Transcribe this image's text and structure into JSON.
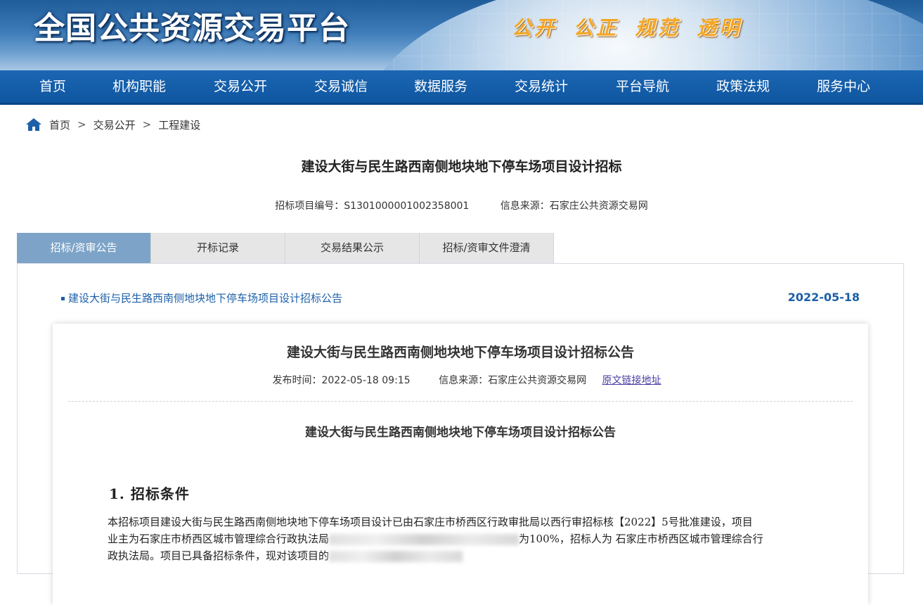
{
  "banner": {
    "site_title": "全国公共资源交易平台",
    "motto": "公开 公正 规范 透明"
  },
  "nav": {
    "items": [
      "首页",
      "机构职能",
      "交易公开",
      "交易诚信",
      "数据服务",
      "交易统计",
      "平台导航",
      "政策法规",
      "服务中心"
    ]
  },
  "breadcrumb": {
    "home": "首页",
    "level1": "交易公开",
    "level2": "工程建设",
    "separator": ">"
  },
  "project": {
    "title": "建设大街与民生路西南侧地块地下停车场项目设计招标",
    "code_label": "招标项目编号：",
    "code": "S1301000001002358001",
    "source_label": "信息来源：",
    "source": "石家庄公共资源交易网"
  },
  "tabs": [
    "招标/资审公告",
    "开标记录",
    "交易结果公示",
    "招标/资审文件澄清"
  ],
  "active_tab": 0,
  "notice": {
    "link_text": "建设大街与民生路西南侧地块地下停车场项目设计招标公告",
    "date": "2022-05-18"
  },
  "document": {
    "title": "建设大街与民生路西南侧地块地下停车场项目设计招标公告",
    "publish_label": "发布时间：",
    "publish_time": "2022-05-18 09:15",
    "source_label": "信息来源：",
    "source": "石家庄公共资源交易网",
    "original_link": "原文链接地址",
    "subtitle": "建设大街与民生路西南侧地块地下停车场项目设计招标公告",
    "section_heading": "1. 招标条件",
    "para_line1": "本招标项目建设大街与民生路西南侧地块地下停车场项目设计已由石家庄市桥西区行政审批局以西行审招标核【2022】5号批准建设，项目",
    "para_line2a": "业主为石家庄市桥西区城市管理综合行政执法局",
    "para_line2b": "为100%，招标人为 石家庄市桥西区城市管理综合行",
    "para_line3a": "政执法局。项目已具备招标条件，现对该项目的",
    "para_line3b": ""
  },
  "colors": {
    "nav_bg": "#0f56a0",
    "tab_active": "#7da4c8",
    "link": "#1c5fa8",
    "motto": "#f5a623"
  }
}
